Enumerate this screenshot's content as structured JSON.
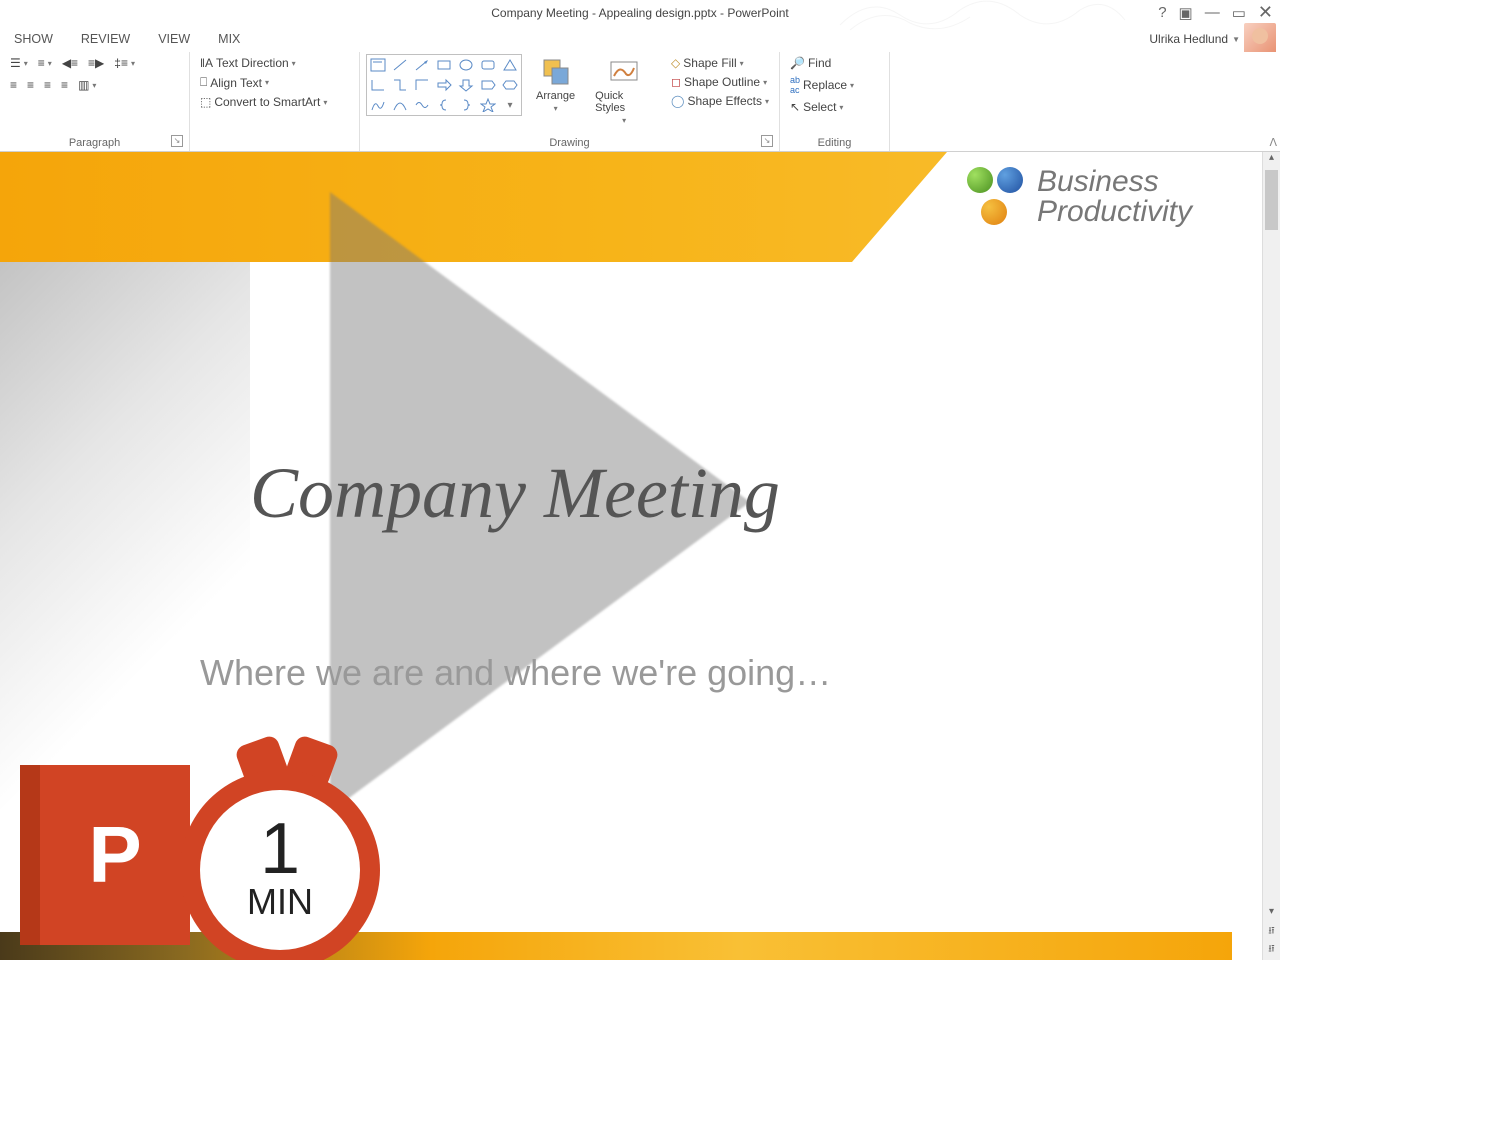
{
  "window": {
    "title": "Company Meeting - Appealing design.pptx - PowerPoint",
    "user": "Ulrika Hedlund"
  },
  "tabs": {
    "show": "SHOW",
    "review": "REVIEW",
    "view": "VIEW",
    "mix": "MIX"
  },
  "ribbon": {
    "paragraph": {
      "label": "Paragraph",
      "text_direction": "Text Direction",
      "align_text": "Align Text",
      "convert_smartart": "Convert to SmartArt"
    },
    "drawing": {
      "label": "Drawing",
      "arrange": "Arrange",
      "quick_styles": "Quick Styles",
      "shape_fill": "Shape Fill",
      "shape_outline": "Shape Outline",
      "shape_effects": "Shape Effects"
    },
    "editing": {
      "label": "Editing",
      "find": "Find",
      "replace": "Replace",
      "select": "Select"
    }
  },
  "slide": {
    "brand_line1": "Business",
    "brand_line2": "Productivity",
    "title": "Company Meeting",
    "subtitle": "Where we are and where we're going…"
  },
  "badge": {
    "p": "P",
    "one": "1",
    "min": "MIN"
  }
}
